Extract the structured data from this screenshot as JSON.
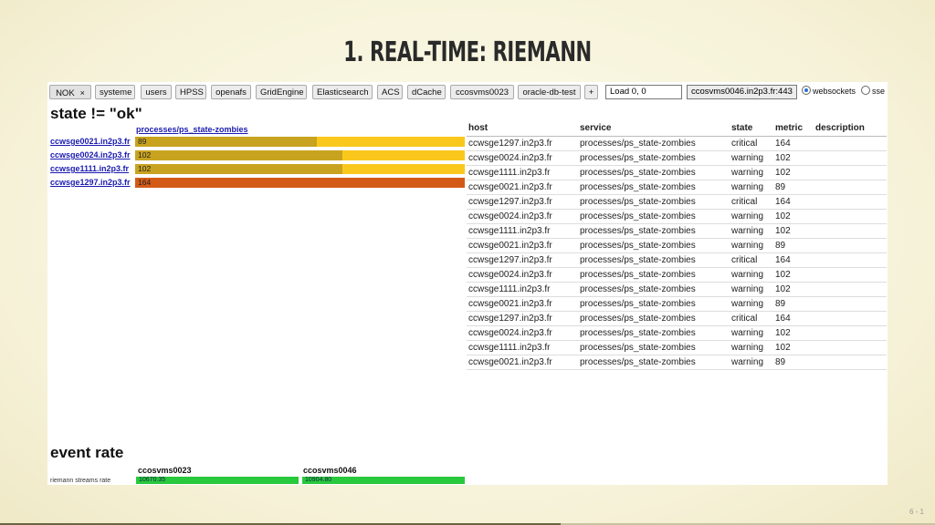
{
  "slide": {
    "title": "1. REAL-TIME: RIEMANN",
    "page": "6 - 1",
    "progress_fraction": 0.6
  },
  "toolbar": {
    "tabs": [
      "NOK",
      "systeme",
      "users",
      "HPSS",
      "openafs",
      "GridEngine",
      "Elasticsearch",
      "ACS",
      "dCache",
      "ccosvms0023",
      "oracle-db-test",
      "+"
    ],
    "close_glyph": "×",
    "query_value": "Load 0, 0",
    "server_value": "ccosvms0046.in2p3.fr:443",
    "transports": [
      "websockets",
      "sse"
    ],
    "selected_transport": "websockets"
  },
  "state_panel": {
    "title": "state != \"ok\"",
    "series_name": "processes/ps_state-zombies",
    "rows": [
      {
        "host": "ccwsge0021.in2p3.fr",
        "value": "89",
        "level": 0.55,
        "color": "#c8a31f"
      },
      {
        "host": "ccwsge0024.in2p3.fr",
        "value": "102",
        "level": 0.63,
        "color": "#c8a31f"
      },
      {
        "host": "ccwsge1111.in2p3.fr",
        "value": "102",
        "level": 0.63,
        "color": "#c8a31f"
      },
      {
        "host": "ccwsge1297.in2p3.fr",
        "value": "164",
        "level": 1.0,
        "color": "#d35a17"
      }
    ],
    "track_color": "#fac81d"
  },
  "events_table": {
    "columns": [
      "host",
      "service",
      "state",
      "metric",
      "description"
    ],
    "rows": [
      [
        "ccwsge1297.in2p3.fr",
        "processes/ps_state-zombies",
        "critical",
        "164",
        ""
      ],
      [
        "ccwsge0024.in2p3.fr",
        "processes/ps_state-zombies",
        "warning",
        "102",
        ""
      ],
      [
        "ccwsge1111.in2p3.fr",
        "processes/ps_state-zombies",
        "warning",
        "102",
        ""
      ],
      [
        "ccwsge0021.in2p3.fr",
        "processes/ps_state-zombies",
        "warning",
        "89",
        ""
      ],
      [
        "ccwsge1297.in2p3.fr",
        "processes/ps_state-zombies",
        "critical",
        "164",
        ""
      ],
      [
        "ccwsge0024.in2p3.fr",
        "processes/ps_state-zombies",
        "warning",
        "102",
        ""
      ],
      [
        "ccwsge1111.in2p3.fr",
        "processes/ps_state-zombies",
        "warning",
        "102",
        ""
      ],
      [
        "ccwsge0021.in2p3.fr",
        "processes/ps_state-zombies",
        "warning",
        "89",
        ""
      ],
      [
        "ccwsge1297.in2p3.fr",
        "processes/ps_state-zombies",
        "critical",
        "164",
        ""
      ],
      [
        "ccwsge0024.in2p3.fr",
        "processes/ps_state-zombies",
        "warning",
        "102",
        ""
      ],
      [
        "ccwsge1111.in2p3.fr",
        "processes/ps_state-zombies",
        "warning",
        "102",
        ""
      ],
      [
        "ccwsge0021.in2p3.fr",
        "processes/ps_state-zombies",
        "warning",
        "89",
        ""
      ],
      [
        "ccwsge1297.in2p3.fr",
        "processes/ps_state-zombies",
        "critical",
        "164",
        ""
      ],
      [
        "ccwsge0024.in2p3.fr",
        "processes/ps_state-zombies",
        "warning",
        "102",
        ""
      ],
      [
        "ccwsge1111.in2p3.fr",
        "processes/ps_state-zombies",
        "warning",
        "102",
        ""
      ],
      [
        "ccwsge0021.in2p3.fr",
        "processes/ps_state-zombies",
        "warning",
        "89",
        ""
      ]
    ]
  },
  "event_rate": {
    "title": "event rate",
    "columns": [
      "ccosvms0023",
      "ccosvms0046"
    ],
    "row_label": "riemann streams rate",
    "values": [
      "10670.35",
      "10904.80"
    ],
    "bar_color": "#28c93c"
  }
}
